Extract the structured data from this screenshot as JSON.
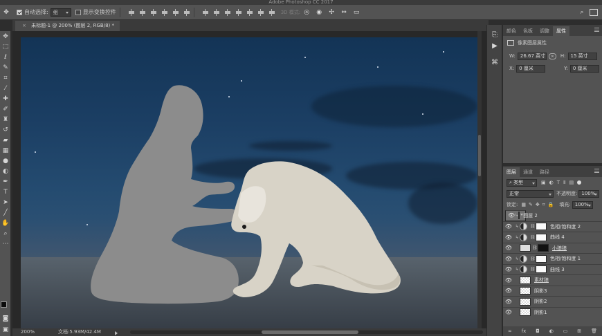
{
  "window": {
    "title": "Adobe Photoshop CC 2017"
  },
  "options_bar": {
    "auto_select_label": "自动选择:",
    "auto_select_value": "组",
    "show_transform_label": "显示变换控件",
    "mode_3d": "3D 模式:"
  },
  "document": {
    "tab_title": "未标题-1 @ 200% (图层 2, RGB/8) *",
    "close_glyph": "×"
  },
  "status": {
    "zoom": "200%",
    "doc_size": "文档:5.93M/42.4M"
  },
  "properties_panel": {
    "tabs": [
      "颜色",
      "色板",
      "调整",
      "属性"
    ],
    "active_tab": "属性",
    "header": "像素图层属性",
    "w_label": "W:",
    "w_value": "26.67 英寸",
    "h_label": "H:",
    "h_value": "15 英寸",
    "x_label": "X:",
    "x_value": "0 厘米",
    "y_label": "Y:",
    "y_value": "0 厘米"
  },
  "layers_panel": {
    "tabs": [
      "图层",
      "通道",
      "路径"
    ],
    "active_tab": "图层",
    "filter_kind": "类型",
    "blend_mode": "正常",
    "opacity_label": "不透明度:",
    "opacity_value": "100%",
    "lock_label": "锁定:",
    "fill_label": "填充:",
    "fill_value": "100%",
    "layers": [
      {
        "name": "图层 2",
        "kind": "pixel",
        "clipped": true,
        "selected": true
      },
      {
        "name": "色相/饱和度 2",
        "kind": "adjust",
        "clipped": true,
        "selected": false
      },
      {
        "name": "曲线 4",
        "kind": "curves",
        "clipped": true,
        "selected": false
      },
      {
        "name": "小狼狼",
        "kind": "wolf",
        "clipped": false,
        "selected": false
      },
      {
        "name": "色相/饱和度 1",
        "kind": "adjust",
        "clipped": true,
        "selected": false
      },
      {
        "name": "曲线 3",
        "kind": "curves",
        "clipped": true,
        "selected": false
      },
      {
        "name": "素材狼",
        "kind": "smart",
        "clipped": false,
        "selected": false
      },
      {
        "name": "阴影3",
        "kind": "shadow",
        "clipped": false,
        "selected": false
      },
      {
        "name": "阴影2",
        "kind": "shadow",
        "clipped": false,
        "selected": false
      },
      {
        "name": "阴影1",
        "kind": "shadow",
        "clipped": false,
        "selected": false
      }
    ],
    "footer_icons": [
      "link",
      "fx",
      "mask",
      "adjustment",
      "group",
      "new-layer",
      "delete"
    ]
  },
  "tools": [
    "move",
    "marquee",
    "lasso",
    "quick-select",
    "crop",
    "eyedropper",
    "healing",
    "brush",
    "clone-stamp",
    "history-brush",
    "eraser",
    "gradient",
    "blur",
    "dodge",
    "pen",
    "type",
    "path-select",
    "shape",
    "hand",
    "zoom",
    "more"
  ],
  "colors": {
    "foreground": "#0b0b0b",
    "background": "#eeeeee",
    "silhouette": "#8b8b8b",
    "wolf": "#d9d4c8"
  }
}
